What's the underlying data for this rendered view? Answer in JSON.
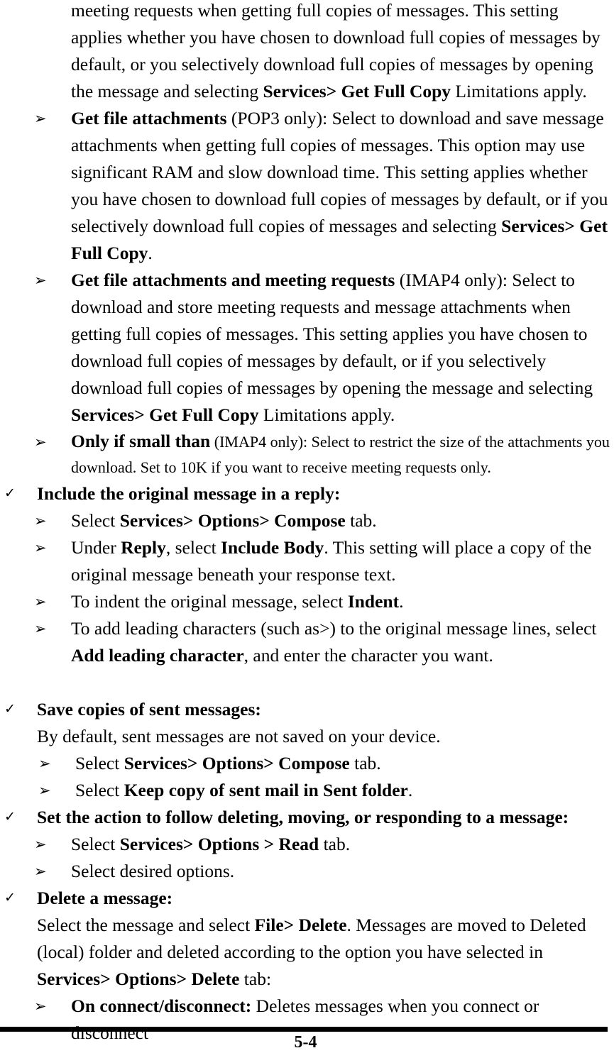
{
  "page": {
    "number_label": "5-4",
    "markers": {
      "check": "✓",
      "chevron": "➢"
    }
  },
  "content": {
    "para_continued": {
      "text": "meeting requests when getting full copies of messages. This setting applies whether you have chosen to download full copies of messages by default, or you selectively download full copies of messages by opening the message and selecting ",
      "bold": "Services> Get Full Copy",
      "tail": " Limitations apply."
    },
    "bullet_get_file_attachments": {
      "bold_lead": "Get file attachments",
      "body": " (POP3 only): Select to download and save message attachments when getting full copies of messages. This option may use significant RAM and slow download time. This setting applies whether you have chosen to download full copies of messages by default, or if you selectively download full copies of messages and selecting ",
      "bold_ref": "Services> Get Full Copy",
      "tail": "."
    },
    "bullet_get_file_attachments_meeting": {
      "bold_lead": "Get file attachments and meeting requests",
      "body": " (IMAP4 only): Select to download and store meeting requests and message attachments when getting full copies of messages. This setting applies you have chosen to download full copies of messages by default, or if you selectively download full copies of messages by opening the message and selecting ",
      "bold_ref": "Services> Get Full Copy",
      "tail": " Limitations apply."
    },
    "bullet_only_if_small_than": {
      "bold_lead": "Only if small than",
      "body": " (IMAP4 only): Select to restrict the size of the attachments you download. Set to 10K if you want to receive meeting requests only."
    },
    "section_include_original": {
      "heading": "Include the original message in a reply:",
      "steps": [
        {
          "lead": "Select ",
          "bold": "Services> Options> Compose",
          "tail": " tab."
        },
        {
          "lead": "Under ",
          "bold": "Reply",
          "mid": ", select ",
          "bold2": "Include Body",
          "tail": ". This setting will place a copy of the original message beneath your response text."
        },
        {
          "lead": "To indent the original message, select ",
          "bold": "Indent",
          "tail": "."
        },
        {
          "lead": "To add leading characters (such as>) to the original message lines, select ",
          "bold": "Add leading character",
          "tail": ", and enter the character you want."
        }
      ]
    },
    "section_save_copies": {
      "heading": "Save copies of sent messages:",
      "body": "By default, sent messages are not saved on your device.",
      "steps": [
        {
          "lead": "Select ",
          "bold": "Services> Options> Compose",
          "tail": " tab."
        },
        {
          "lead": "Select ",
          "bold": "Keep copy of sent mail in Sent folder",
          "tail": "."
        }
      ]
    },
    "section_set_action": {
      "heading": "Set the action to follow deleting, moving, or responding to a message:",
      "steps": [
        {
          "lead": "Select ",
          "bold": "Services> Options > Read",
          "tail": " tab."
        },
        {
          "lead": "Select desired options.",
          "bold": "",
          "tail": ""
        }
      ]
    },
    "section_delete_message": {
      "heading": "Delete a message:",
      "body_lead": "Select the message and select ",
      "body_bold": "File> Delete",
      "body_mid": ". Messages are moved to Deleted (local) folder and deleted according to the option you have selected in ",
      "body_bold2": "Services> Options> Delete",
      "body_tail": " tab:",
      "steps": [
        {
          "bold_lead": "On connect/disconnect:",
          "body": " Deletes messages when you connect or disconnect"
        }
      ]
    }
  }
}
